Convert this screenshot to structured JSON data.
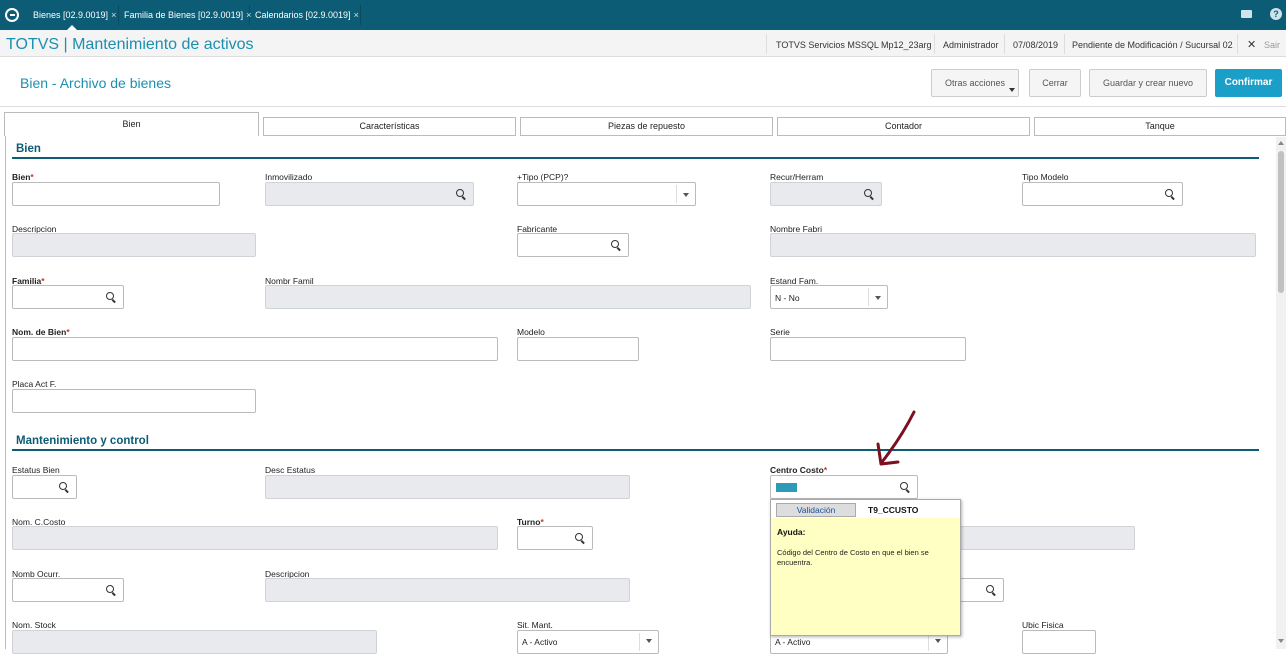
{
  "tabs": [
    {
      "label": "Bienes [02.9.0019]",
      "active": true
    },
    {
      "label": "Familia de Bienes [02.9.0019]"
    },
    {
      "label": "Calendarios [02.9.0019]"
    }
  ],
  "tab_close": "×",
  "header": {
    "app_title": "TOTVS | Mantenimiento de activos",
    "server": "TOTVS Servicios MSSQL Mp12_23arg",
    "user": "Administrador",
    "date": "07/08/2019",
    "status": "Pendiente de Modificación / Sucursal 02",
    "exit_label": "Sair",
    "exit_icon": "✕"
  },
  "page": {
    "title": "Bien - Archivo de bienes",
    "buttons": {
      "otras": "Otras acciones",
      "cerrar": "Cerrar",
      "guardar": "Guardar y crear nuevo",
      "confirmar": "Confirmar"
    }
  },
  "form_tabs": [
    "Bien",
    "Características",
    "Piezas de repuesto",
    "Contador",
    "Tanque"
  ],
  "sections": {
    "bien": "Bien",
    "mant": "Mantenimiento y control"
  },
  "required_mark": "*",
  "fields": {
    "bien": "Bien",
    "inmovilizado": "Inmovilizado",
    "tipo_pcp": "+Tipo (PCP)?",
    "recur": "Recur/Herram",
    "tipo_modelo": "Tipo Modelo",
    "descripcion": "Descripcion",
    "fabricante": "Fabricante",
    "nombre_fabri": "Nombre Fabri",
    "familia": "Familia",
    "nombr_famil": "Nombr Famil",
    "estand_fam": "Estand Fam.",
    "estand_fam_value": "N - No",
    "nom_bien": "Nom. de Bien",
    "modelo": "Modelo",
    "serie": "Serie",
    "placa": "Placa Act F.",
    "estatus_bien": "Estatus Bien",
    "desc_estatus": "Desc Estatus",
    "centro_costo": "Centro Costo",
    "nom_ccosto": "Nom. C.Costo",
    "turno": "Turno",
    "nomb_ocurr": "Nomb Ocurr.",
    "descripcion2": "Descripcion",
    "nom_stock": "Nom. Stock",
    "sit_mant": "Sit. Mant.",
    "sit_mant_value": "A - Activo",
    "sit_value2": "A - Activo",
    "ubic_fisica": "Ubic Fisica"
  },
  "tooltip": {
    "tab": "Validación",
    "code": "T9_CCUSTO",
    "ayuda": "Ayuda:",
    "text": "Código del Centro de Costo en que el bien se encuentra."
  },
  "colors": {
    "topbar": "#0d5c75",
    "accent": "#1b8fb0",
    "primary_button": "#1a9fc9",
    "required": "#c0392b",
    "tooltip_bg": "#ffffc4",
    "annotation_arrow": "#7a1020"
  },
  "icons": {
    "logo": "totvs-logo-icon",
    "mail": "mail-icon",
    "help": "help-icon",
    "search": "search-icon",
    "dropdown": "chevron-down-icon"
  }
}
